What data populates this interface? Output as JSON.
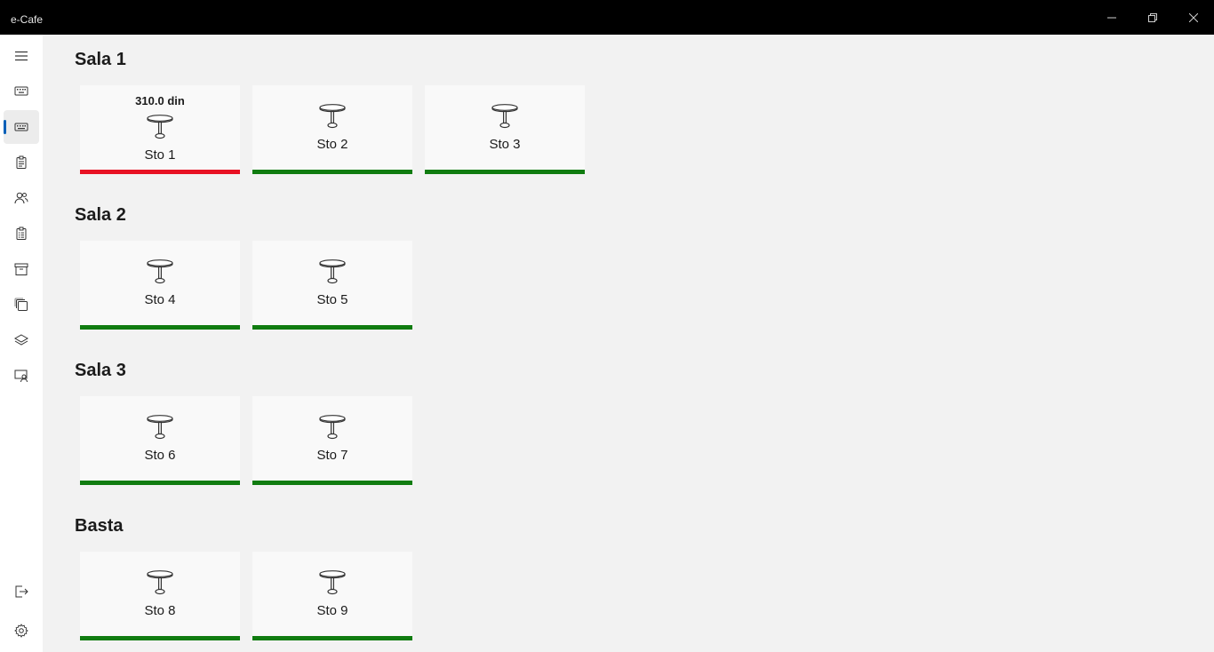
{
  "window": {
    "title": "e-Cafe",
    "controls": [
      "minimize-icon",
      "restore-icon",
      "close-icon"
    ]
  },
  "nav": {
    "items": [
      {
        "icon": "hamburger-menu-icon"
      },
      {
        "icon": "keyboard-icon"
      },
      {
        "icon": "keyboard-icon"
      },
      {
        "icon": "clipboard-icon"
      },
      {
        "icon": "users-icon"
      },
      {
        "icon": "clipboard-list-icon"
      },
      {
        "icon": "archive-icon"
      },
      {
        "icon": "copy-stack-icon"
      },
      {
        "icon": "layers-icon"
      },
      {
        "icon": "user-monitor-icon"
      }
    ],
    "bottom_items": [
      {
        "icon": "sign-out-icon"
      },
      {
        "icon": "gear-icon"
      }
    ]
  },
  "sections": [
    {
      "title": "Sala 1",
      "tables": [
        {
          "name": "Sto 1",
          "amount": "310.0 din",
          "status_color": "#e81123"
        },
        {
          "name": "Sto 2",
          "amount": "",
          "status_color": "#107c10"
        },
        {
          "name": "Sto 3",
          "amount": "",
          "status_color": "#107c10"
        }
      ]
    },
    {
      "title": "Sala 2",
      "tables": [
        {
          "name": "Sto 4",
          "amount": "",
          "status_color": "#107c10"
        },
        {
          "name": "Sto 5",
          "amount": "",
          "status_color": "#107c10"
        }
      ]
    },
    {
      "title": "Sala 3",
      "tables": [
        {
          "name": "Sto 6",
          "amount": "",
          "status_color": "#107c10"
        },
        {
          "name": "Sto 7",
          "amount": "",
          "status_color": "#107c10"
        }
      ]
    },
    {
      "title": "Basta",
      "tables": [
        {
          "name": "Sto 8",
          "amount": "",
          "status_color": "#107c10"
        },
        {
          "name": "Sto 9",
          "amount": "",
          "status_color": "#107c10"
        }
      ]
    }
  ],
  "colors": {
    "accent": "#005fb8",
    "occupied": "#e81123",
    "free": "#107c10"
  }
}
